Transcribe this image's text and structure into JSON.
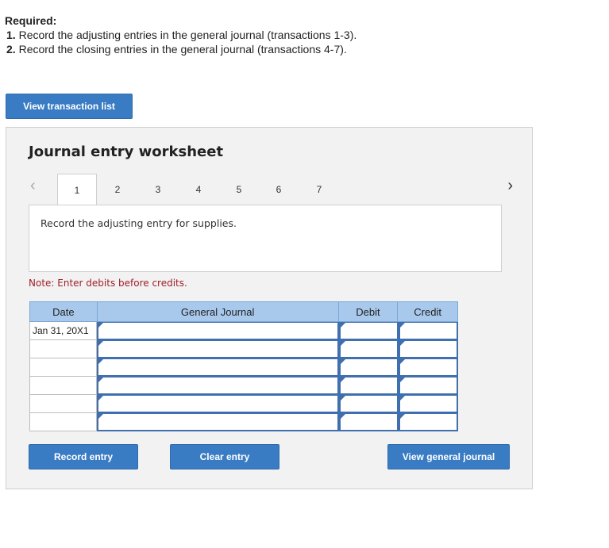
{
  "required": {
    "title": "Required:",
    "items": [
      {
        "num": "1.",
        "text": "Record the adjusting entries in the general journal (transactions 1-3)."
      },
      {
        "num": "2.",
        "text": "Record the closing entries in the general journal (transactions 4-7)."
      }
    ]
  },
  "view_transaction_list_label": "View transaction list",
  "worksheet": {
    "title": "Journal entry worksheet",
    "tabs": [
      "1",
      "2",
      "3",
      "4",
      "5",
      "6",
      "7"
    ],
    "active_tab": "1",
    "prev_icon": "chevron-left-icon",
    "next_icon": "chevron-right-icon",
    "description": "Record the adjusting entry for supplies.",
    "note": "Note: Enter debits before credits.",
    "columns": {
      "date": "Date",
      "general_journal": "General Journal",
      "debit": "Debit",
      "credit": "Credit"
    },
    "rows": [
      {
        "date": "Jan 31, 20X1",
        "account": "",
        "debit": "",
        "credit": ""
      },
      {
        "date": "",
        "account": "",
        "debit": "",
        "credit": ""
      },
      {
        "date": "",
        "account": "",
        "debit": "",
        "credit": ""
      },
      {
        "date": "",
        "account": "",
        "debit": "",
        "credit": ""
      },
      {
        "date": "",
        "account": "",
        "debit": "",
        "credit": ""
      },
      {
        "date": "",
        "account": "",
        "debit": "",
        "credit": ""
      }
    ],
    "record_entry_label": "Record entry",
    "clear_entry_label": "Clear entry",
    "view_general_journal_label": "View general journal"
  },
  "colors": {
    "button_blue": "#3a7cc4",
    "header_blue": "#a8c8ec",
    "input_border": "#3f6fae",
    "note_red": "#a0202a",
    "panel_bg": "#f2f2f2"
  }
}
